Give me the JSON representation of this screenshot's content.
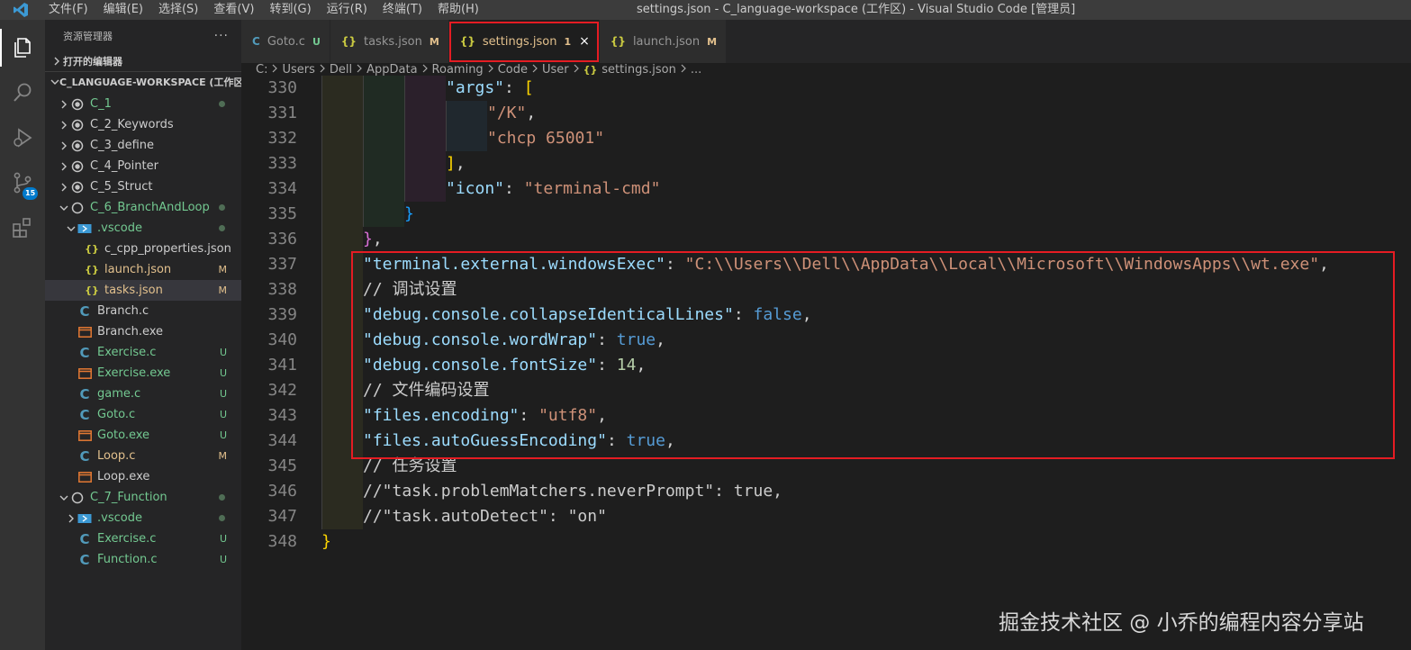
{
  "window": {
    "title": "settings.json - C_language-workspace (工作区) - Visual Studio Code [管理员]",
    "menu": [
      "文件(F)",
      "编辑(E)",
      "选择(S)",
      "查看(V)",
      "转到(G)",
      "运行(R)",
      "终端(T)",
      "帮助(H)"
    ]
  },
  "activity": {
    "scm_badge": "15"
  },
  "sidebar": {
    "title": "资源管理器",
    "more": "···",
    "open_editors": "打开的编辑器",
    "workspace": "C_LANGUAGE-WORKSPACE (工作区)",
    "items": [
      {
        "label": "C_1",
        "indent": 0,
        "chevron": "right",
        "icon": "folder-root",
        "decor": "dot",
        "color": "green"
      },
      {
        "label": "C_2_Keywords",
        "indent": 0,
        "chevron": "right",
        "icon": "folder-root",
        "decor": "",
        "color": "normal"
      },
      {
        "label": "C_3_define",
        "indent": 0,
        "chevron": "right",
        "icon": "folder-root",
        "decor": "",
        "color": "normal"
      },
      {
        "label": "C_4_Pointer",
        "indent": 0,
        "chevron": "right",
        "icon": "folder-root",
        "decor": "",
        "color": "normal"
      },
      {
        "label": "C_5_Struct",
        "indent": 0,
        "chevron": "right",
        "icon": "folder-root",
        "decor": "",
        "color": "normal"
      },
      {
        "label": "C_6_BranchAndLoop",
        "indent": 0,
        "chevron": "down",
        "icon": "folder-root-open",
        "decor": "dot",
        "color": "green"
      },
      {
        "label": ".vscode",
        "indent": 1,
        "chevron": "down",
        "icon": "vscode-folder",
        "decor": "dot",
        "color": "green"
      },
      {
        "label": "c_cpp_properties.json",
        "indent": 2,
        "chevron": "",
        "icon": "json",
        "decor": "",
        "color": "normal"
      },
      {
        "label": "launch.json",
        "indent": 2,
        "chevron": "",
        "icon": "json",
        "decor": "M",
        "color": "orange"
      },
      {
        "label": "tasks.json",
        "indent": 2,
        "chevron": "",
        "icon": "json",
        "decor": "M",
        "color": "orange",
        "selected": true
      },
      {
        "label": "Branch.c",
        "indent": 1,
        "chevron": "",
        "icon": "c",
        "decor": "",
        "color": "normal"
      },
      {
        "label": "Branch.exe",
        "indent": 1,
        "chevron": "",
        "icon": "exe",
        "decor": "",
        "color": "normal"
      },
      {
        "label": "Exercise.c",
        "indent": 1,
        "chevron": "",
        "icon": "c",
        "decor": "U",
        "color": "green"
      },
      {
        "label": "Exercise.exe",
        "indent": 1,
        "chevron": "",
        "icon": "exe",
        "decor": "U",
        "color": "green"
      },
      {
        "label": "game.c",
        "indent": 1,
        "chevron": "",
        "icon": "c",
        "decor": "U",
        "color": "green"
      },
      {
        "label": "Goto.c",
        "indent": 1,
        "chevron": "",
        "icon": "c",
        "decor": "U",
        "color": "green"
      },
      {
        "label": "Goto.exe",
        "indent": 1,
        "chevron": "",
        "icon": "exe",
        "decor": "U",
        "color": "green"
      },
      {
        "label": "Loop.c",
        "indent": 1,
        "chevron": "",
        "icon": "c",
        "decor": "M",
        "color": "orange"
      },
      {
        "label": "Loop.exe",
        "indent": 1,
        "chevron": "",
        "icon": "exe",
        "decor": "",
        "color": "normal"
      },
      {
        "label": "C_7_Function",
        "indent": 0,
        "chevron": "down",
        "icon": "folder-root-open",
        "decor": "dot",
        "color": "green"
      },
      {
        "label": ".vscode",
        "indent": 1,
        "chevron": "right",
        "icon": "vscode-folder",
        "decor": "dot",
        "color": "green"
      },
      {
        "label": "Exercise.c",
        "indent": 1,
        "chevron": "",
        "icon": "c",
        "decor": "U",
        "color": "green"
      },
      {
        "label": "Function.c",
        "indent": 1,
        "chevron": "",
        "icon": "c",
        "decor": "U",
        "color": "green"
      }
    ]
  },
  "tabs": [
    {
      "label": "Goto.c",
      "icon": "C",
      "flag": "U",
      "flag_color": "#73c991"
    },
    {
      "label": "tasks.json",
      "icon": "{}",
      "flag": "M",
      "flag_color": "#e2c08d"
    },
    {
      "label": "settings.json",
      "icon": "{}",
      "flag": "1",
      "flag_color": "#e2c08d",
      "active": true,
      "close": "×"
    },
    {
      "label": "launch.json",
      "icon": "{}",
      "flag": "M",
      "flag_color": "#e2c08d"
    }
  ],
  "breadcrumb": [
    "C:",
    "Users",
    "Dell",
    "AppData",
    "Roaming",
    "Code",
    "User",
    "settings.json",
    "..."
  ],
  "editor": {
    "lines": [
      {
        "no": "330",
        "indent": 3,
        "tokens": [
          [
            "k",
            "\"args\""
          ],
          [
            "p",
            ": "
          ],
          [
            "br1",
            "["
          ]
        ]
      },
      {
        "no": "331",
        "indent": 4,
        "tokens": [
          [
            "s",
            "\"/K\""
          ],
          [
            "p",
            ","
          ]
        ]
      },
      {
        "no": "332",
        "indent": 4,
        "tokens": [
          [
            "s",
            "\"chcp 65001\""
          ]
        ]
      },
      {
        "no": "333",
        "indent": 3,
        "tokens": [
          [
            "br1",
            "]"
          ],
          [
            "p",
            ","
          ]
        ]
      },
      {
        "no": "334",
        "indent": 3,
        "tokens": [
          [
            "k",
            "\"icon\""
          ],
          [
            "p",
            ": "
          ],
          [
            "s",
            "\"terminal-cmd\""
          ]
        ]
      },
      {
        "no": "335",
        "indent": 2,
        "tokens": [
          [
            "br3",
            "}"
          ]
        ]
      },
      {
        "no": "336",
        "indent": 1,
        "tokens": [
          [
            "br2",
            "}"
          ],
          [
            "p",
            ","
          ]
        ]
      },
      {
        "no": "337",
        "indent": 1,
        "tokens": [
          [
            "k",
            "\"terminal.external.windowsExec\""
          ],
          [
            "p",
            ": "
          ],
          [
            "s",
            "\"C:\\\\Users\\\\Dell\\\\AppData\\\\Local\\\\Microsoft\\\\WindowsApps\\\\wt.exe\""
          ],
          [
            "p",
            ","
          ]
        ]
      },
      {
        "no": "338",
        "indent": 1,
        "tokens": [
          [
            "cm",
            "// 调试设置"
          ]
        ]
      },
      {
        "no": "339",
        "indent": 1,
        "tokens": [
          [
            "k",
            "\"debug.console.collapseIdenticalLines\""
          ],
          [
            "p",
            ": "
          ],
          [
            "b",
            "false"
          ],
          [
            "p",
            ","
          ]
        ]
      },
      {
        "no": "340",
        "indent": 1,
        "tokens": [
          [
            "k",
            "\"debug.console.wordWrap\""
          ],
          [
            "p",
            ": "
          ],
          [
            "b",
            "true"
          ],
          [
            "p",
            ","
          ]
        ]
      },
      {
        "no": "341",
        "indent": 1,
        "tokens": [
          [
            "k",
            "\"debug.console.fontSize\""
          ],
          [
            "p",
            ": "
          ],
          [
            "n",
            "14"
          ],
          [
            "p",
            ","
          ]
        ]
      },
      {
        "no": "342",
        "indent": 1,
        "tokens": [
          [
            "cm",
            "// 文件编码设置"
          ]
        ]
      },
      {
        "no": "343",
        "indent": 1,
        "tokens": [
          [
            "k",
            "\"files.encoding\""
          ],
          [
            "p",
            ": "
          ],
          [
            "s",
            "\"utf8\""
          ],
          [
            "p",
            ","
          ]
        ]
      },
      {
        "no": "344",
        "indent": 1,
        "tokens": [
          [
            "k",
            "\"files.autoGuessEncoding\""
          ],
          [
            "p",
            ": "
          ],
          [
            "b",
            "true"
          ],
          [
            "p",
            ","
          ]
        ]
      },
      {
        "no": "345",
        "indent": 1,
        "tokens": [
          [
            "cm",
            "// 任务设置"
          ]
        ]
      },
      {
        "no": "346",
        "indent": 1,
        "tokens": [
          [
            "cm",
            "//\"task.problemMatchers.neverPrompt\": true,"
          ]
        ]
      },
      {
        "no": "347",
        "indent": 1,
        "tokens": [
          [
            "cm",
            "//\"task.autoDetect\": \"on\""
          ]
        ]
      },
      {
        "no": "348",
        "indent": 0,
        "tokens": [
          [
            "br1",
            "}"
          ]
        ]
      }
    ]
  },
  "watermark": "掘金技术社区 @ 小乔的编程内容分享站"
}
